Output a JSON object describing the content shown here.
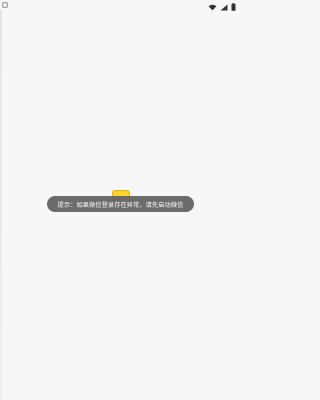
{
  "status_bar": {
    "left_icon": "square-icon",
    "right_icons": [
      "wifi-icon",
      "signal-icon",
      "battery-icon"
    ]
  },
  "toast": {
    "message": "提示：如果微信登录存在异常，请先启动微信"
  },
  "colors": {
    "background": "#f7f7f7",
    "toast_bg": "#646464",
    "toast_text": "#ffffff",
    "accent_yellow": "#ffd335"
  }
}
